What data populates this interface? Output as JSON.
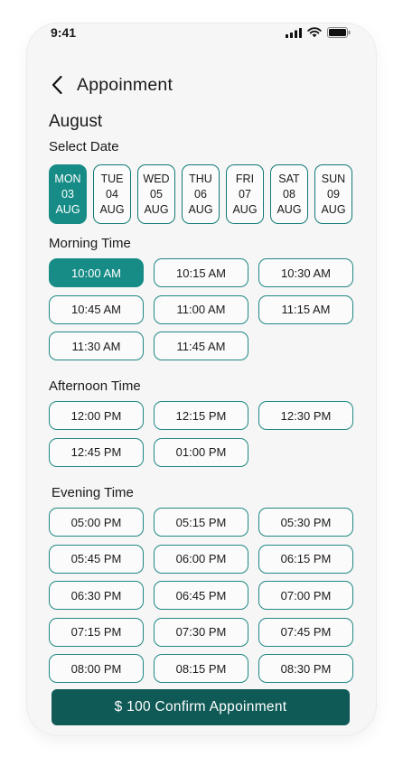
{
  "status_bar": {
    "time": "9:41"
  },
  "header": {
    "title": "Appoinment"
  },
  "month": "August",
  "select_date_label": "Select Date",
  "dates": [
    {
      "day": "MON",
      "date": "03",
      "month": "AUG",
      "selected": true
    },
    {
      "day": "TUE",
      "date": "04",
      "month": "AUG",
      "selected": false
    },
    {
      "day": "WED",
      "date": "05",
      "month": "AUG",
      "selected": false
    },
    {
      "day": "THU",
      "date": "06",
      "month": "AUG",
      "selected": false
    },
    {
      "day": "FRI",
      "date": "07",
      "month": "AUG",
      "selected": false
    },
    {
      "day": "SAT",
      "date": "08",
      "month": "AUG",
      "selected": false
    },
    {
      "day": "SUN",
      "date": "09",
      "month": "AUG",
      "selected": false
    }
  ],
  "morning": {
    "label": "Morning Time",
    "slots": [
      "10:00 AM",
      "10:15 AM",
      "10:30 AM",
      "10:45 AM",
      "11:00 AM",
      "11:15 AM",
      "11:30 AM",
      "11:45 AM"
    ],
    "selected": "10:00 AM"
  },
  "afternoon": {
    "label": "Afternoon Time",
    "slots": [
      "12:00 PM",
      "12:15 PM",
      "12:30 PM",
      "12:45 PM",
      "01:00 PM"
    ]
  },
  "evening": {
    "label": "Evening Time",
    "slots": [
      "05:00 PM",
      "05:15 PM",
      "05:30 PM",
      "05:45 PM",
      "06:00 PM",
      "06:15 PM",
      "06:30 PM",
      "06:45 PM",
      "07:00 PM",
      "07:15 PM",
      "07:30 PM",
      "07:45 PM",
      "08:00 PM",
      "08:15 PM",
      "08:30 PM"
    ]
  },
  "confirm_button": {
    "label": "$ 100 Confirm Appoinment"
  },
  "colors": {
    "accent": "#178c86",
    "accent_border": "#1f8883",
    "button_dark": "#0f5a56",
    "background": "#f6f6f6"
  }
}
